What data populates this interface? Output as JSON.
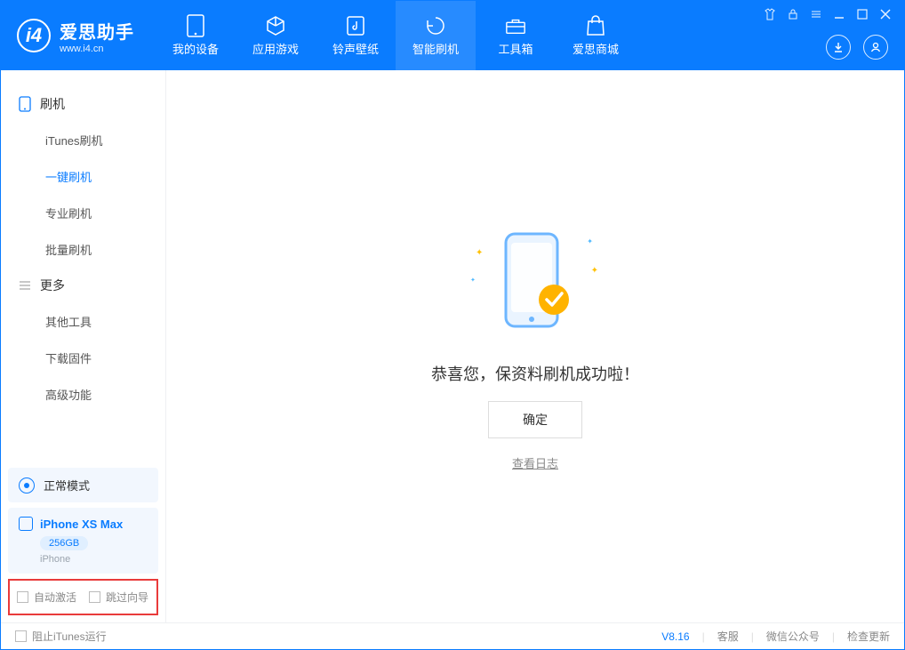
{
  "app": {
    "title": "爱思助手",
    "subtitle": "www.i4.cn"
  },
  "nav": {
    "tabs": [
      {
        "label": "我的设备"
      },
      {
        "label": "应用游戏"
      },
      {
        "label": "铃声壁纸"
      },
      {
        "label": "智能刷机"
      },
      {
        "label": "工具箱"
      },
      {
        "label": "爱思商城"
      }
    ]
  },
  "sidebar": {
    "group1": {
      "title": "刷机"
    },
    "items1": [
      {
        "label": "iTunes刷机"
      },
      {
        "label": "一键刷机"
      },
      {
        "label": "专业刷机"
      },
      {
        "label": "批量刷机"
      }
    ],
    "group2": {
      "title": "更多"
    },
    "items2": [
      {
        "label": "其他工具"
      },
      {
        "label": "下载固件"
      },
      {
        "label": "高级功能"
      }
    ],
    "mode": {
      "label": "正常模式"
    },
    "device": {
      "name": "iPhone XS Max",
      "capacity": "256GB",
      "type": "iPhone"
    },
    "opts": {
      "auto_activate": "自动激活",
      "skip_guide": "跳过向导"
    }
  },
  "main": {
    "success_text": "恭喜您，保资料刷机成功啦！",
    "ok_label": "确定",
    "log_link": "查看日志"
  },
  "footer": {
    "block_itunes": "阻止iTunes运行",
    "version": "V8.16",
    "links": {
      "support": "客服",
      "wechat": "微信公众号",
      "update": "检查更新"
    }
  }
}
